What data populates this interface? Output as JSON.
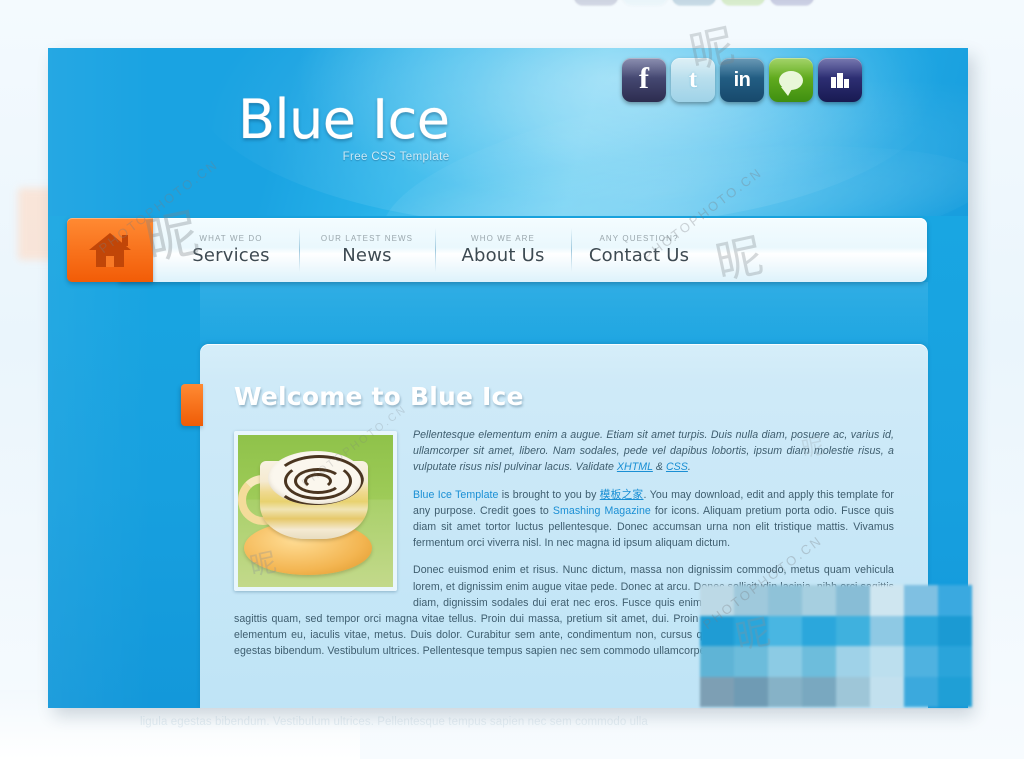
{
  "site": {
    "logo_title": "Blue Ice",
    "logo_tagline": "Free CSS Template"
  },
  "social": [
    {
      "name": "facebook",
      "glyph": "f",
      "color": "#2c2c4f"
    },
    {
      "name": "twitter",
      "glyph": "t",
      "color": "#9fd3e8"
    },
    {
      "name": "linkedin",
      "glyph": "in",
      "color": "#17496c"
    },
    {
      "name": "chat",
      "glyph": "",
      "color": "#3f8f10"
    },
    {
      "name": "myspace",
      "glyph": "",
      "color": "#181a52"
    }
  ],
  "nav": {
    "home_icon": "house-icon",
    "items": [
      {
        "kicker": "WHAT WE DO",
        "label": "Services"
      },
      {
        "kicker": "OUR LATEST NEWS",
        "label": "News"
      },
      {
        "kicker": "WHO WE ARE",
        "label": "About Us"
      },
      {
        "kicker": "ANY QUESTION?",
        "label": "Contact Us"
      }
    ]
  },
  "content": {
    "title": "Welcome to Blue Ice",
    "thumbnail_alt": "coffee-cup-photo",
    "p1_a": "Pellentesque elementum enim a augue. Etiam sit amet turpis. Duis nulla diam, posuere ac, varius id, ullamcorper sit amet, libero. Nam sodales, pede vel dapibus lobortis, ipsum diam molestie risus, a vulputate risus nisl pulvinar lacus. Validate ",
    "p1_link1": "XHTML",
    "p1_amp": " & ",
    "p1_link2": "CSS",
    "p1_end": ".",
    "p2_link1": "Blue Ice Template",
    "p2_a": " is brought to you by ",
    "p2_link2": "模板之家",
    "p2_b": ". You may download, edit and apply this template for any purpose. Credit goes to ",
    "p2_link3": "Smashing Magazine",
    "p2_c": " for icons. Aliquam pretium porta odio. Fusce quis diam sit amet tortor luctus pellentesque. Donec accumsan urna non elit tristique mattis. Vivamus fermentum orci viverra nisl. In nec magna id ipsum aliquam dictum.",
    "p3": "Donec euismod enim et risus. Nunc dictum, massa non dignissim commodo, metus quam vehicula lorem, et dignissim enim augue vitae pede. Donec at arcu. Donec sollicitudin lacinia, nibh orci sagittis diam, dignissim sodales dui erat nec eros. Fusce quis enim. Aliquam elementum sodales, odio erat sagittis quam, sed tempor orci magna vitae tellus. Proin dui massa, pretium sit amet, dui. Proin vulputate justo et quam. Cras nisl eros, elementum eu, iaculis vitae, metus. Duis dolor. Curabitur sem ante, condimentum non, cursus quis, eleifend non, libero. Nunc eu ligula egestas bibendum. Vestibulum ultrices. Pellentesque tempus sapien nec sem commodo ullamcorper."
  },
  "reflection": {
    "ghost_line": "ligula egestas bibendum. Vestibulum ultrices. Pellentesque tempus sapien nec sem commodo ulla"
  },
  "watermark": {
    "text": "PHOTOPHOTO.CN",
    "mark": "昵"
  },
  "colors": {
    "accent_orange": "#f2650a",
    "header_blue": "#1aa3e2",
    "body_blue": "#17a0df",
    "panel_blue": "#cfeaf8",
    "link_blue": "#1a8fd4"
  }
}
